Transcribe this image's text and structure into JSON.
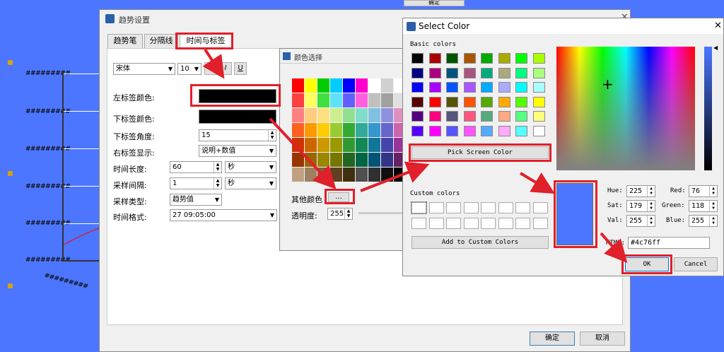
{
  "background": {
    "hash_label": "#########",
    "rotated_label": "#########"
  },
  "trend_dialog": {
    "title": "趋势设置",
    "tabs": [
      "趋势笔",
      "分隔线",
      "时间与标签"
    ],
    "font": {
      "family": "宋体",
      "size": "10",
      "bold": "B",
      "italic": "I",
      "underline": "U"
    },
    "rows": [
      {
        "label": "左标签颜色:"
      },
      {
        "label": "下标签颜色:"
      },
      {
        "label": "下标签角度:",
        "value": "15"
      },
      {
        "label": "右标签显示:",
        "value": "说明+数值"
      },
      {
        "label": "时间长度:",
        "value": "60",
        "unit": "秒"
      },
      {
        "label": "采样间隔:",
        "value": "1",
        "unit": "秒"
      },
      {
        "label": "采样类型:",
        "value": "趋势值"
      },
      {
        "label": "时间格式:",
        "value": "27 09:05:00"
      }
    ],
    "ok": "确定",
    "cancel": "取消"
  },
  "color_chooser": {
    "title": "颜色选择",
    "other": "其他颜色",
    "more_button": "...",
    "opacity_label": "透明度:",
    "opacity_value": "255",
    "palette": [
      [
        "#ff0000",
        "#ffff00",
        "#00cc00",
        "#00ccff",
        "#0000ff",
        "#ff00cc",
        "#ffffff",
        "#d0d0d0",
        "#ffffff"
      ],
      [
        "#ff4040",
        "#ffff60",
        "#40e040",
        "#60e0ff",
        "#6060ff",
        "#ff60e0",
        "#c0c0c0",
        "#a0a0a0",
        "#e0e0e0"
      ],
      [
        "#ff8080",
        "#ffcc80",
        "#ffe080",
        "#ccee90",
        "#90e090",
        "#80ddcc",
        "#80c0e0",
        "#9090e0",
        "#e090c0"
      ],
      [
        "#ff6020",
        "#ff9900",
        "#ffcc00",
        "#99cc33",
        "#33aa33",
        "#33aa99",
        "#3399cc",
        "#6666cc",
        "#cc66aa"
      ],
      [
        "#cc3300",
        "#cc6600",
        "#cc9900",
        "#999900",
        "#339933",
        "#118855",
        "#117799",
        "#4444aa",
        "#993399"
      ],
      [
        "#993300",
        "#996600",
        "#998800",
        "#777700",
        "#226622",
        "#006644",
        "#005577",
        "#333388",
        "#662266"
      ],
      [
        "#c0a080",
        "#a08060",
        "#806040",
        "#604020",
        "#403010",
        "#505050",
        "#303030",
        "#101010",
        "#000000"
      ]
    ]
  },
  "select_color": {
    "title": "Select Color",
    "basic_colors": "Basic colors",
    "basic": [
      [
        "#000000",
        "#aa0000",
        "#005500",
        "#aa5500",
        "#00aa00",
        "#aaaa00",
        "#00ff00",
        "#aaff00"
      ],
      [
        "#00007f",
        "#aa007f",
        "#00557f",
        "#aa557f",
        "#00aa7f",
        "#aaaa7f",
        "#00ff7f",
        "#aaff7f"
      ],
      [
        "#0000ff",
        "#aa00ff",
        "#0055ff",
        "#aa55ff",
        "#00aaff",
        "#aaaaff",
        "#00ffff",
        "#aaffff"
      ],
      [
        "#550000",
        "#ff0000",
        "#555500",
        "#ff5500",
        "#55aa00",
        "#ffaa00",
        "#55ff00",
        "#ffff00"
      ],
      [
        "#55007f",
        "#ff007f",
        "#55557f",
        "#ff557f",
        "#55aa7f",
        "#ffaa7f",
        "#55ff7f",
        "#ffff7f"
      ],
      [
        "#5500ff",
        "#ff00ff",
        "#5555ff",
        "#ff55ff",
        "#55aaff",
        "#ffaaff",
        "#55ffff",
        "#ffffff"
      ]
    ],
    "pick_screen": "Pick Screen Color",
    "custom_colors": "Custom colors",
    "add_custom": "Add to Custom Colors",
    "hue_label": "Hue:",
    "hue": "225",
    "sat_label": "Sat:",
    "sat": "179",
    "val_label": "Val:",
    "val": "255",
    "red_label": "Red:",
    "red": "76",
    "green_label": "Green:",
    "green": "118",
    "blue_label": "Blue:",
    "blue": "255",
    "html_label": "HTML:",
    "html": "#4c76ff",
    "ok": "OK",
    "cancel": "Cancel",
    "selected_color": "#4c76ff"
  },
  "top_partial_button": "确定"
}
